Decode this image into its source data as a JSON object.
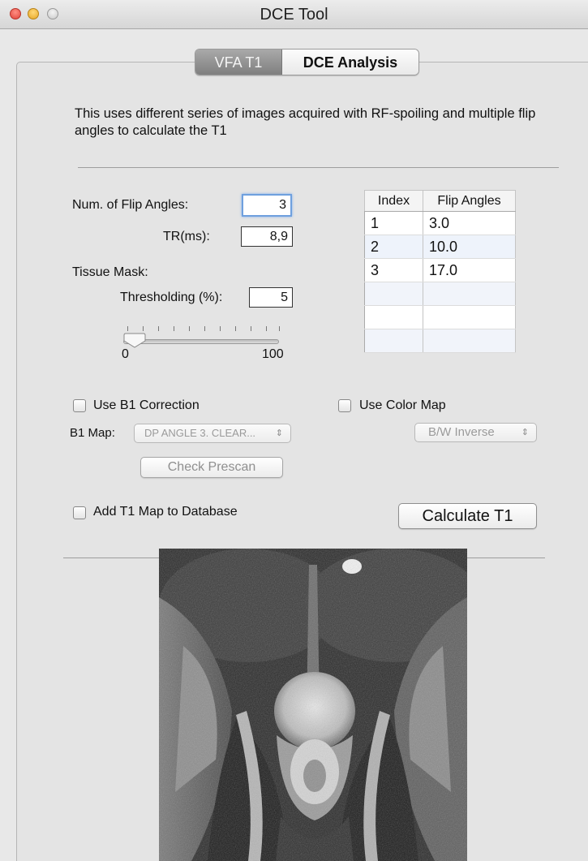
{
  "window": {
    "title": "DCE Tool"
  },
  "tabs": [
    {
      "label": "VFA T1",
      "active": true
    },
    {
      "label": "DCE Analysis",
      "active": false
    }
  ],
  "description": "This uses different series of images acquired with RF-spoiling and multiple flip angles to calculate the T1",
  "form": {
    "num_flip_angles_label": "Num. of Flip Angles:",
    "num_flip_angles_value": "3",
    "tr_label": "TR(ms):",
    "tr_value": "8,9",
    "tissue_mask_label": "Tissue Mask:",
    "thresholding_label": "Thresholding (%):",
    "thresholding_value": "5",
    "slider": {
      "min_label": "0",
      "max_label": "100",
      "value": 5
    }
  },
  "flip_table": {
    "headers": [
      "Index",
      "Flip Angles"
    ],
    "rows": [
      [
        "1",
        "3.0"
      ],
      [
        "2",
        "10.0"
      ],
      [
        "3",
        "17.0"
      ],
      [
        "",
        ""
      ],
      [
        "",
        ""
      ],
      [
        "",
        ""
      ]
    ]
  },
  "options": {
    "b1_correction_label": "Use B1 Correction",
    "b1_correction_checked": false,
    "color_map_label": "Use Color Map",
    "color_map_checked": false,
    "b1_map_label": "B1 Map:",
    "b1_map_selected": "DP ANGLE 3. CLEAR...",
    "color_map_selected": "B/W Inverse",
    "check_prescan_label": "Check Prescan",
    "add_t1_label": "Add T1 Map to Database",
    "add_t1_checked": false,
    "calculate_label": "Calculate T1"
  },
  "colors": {
    "focus_ring": "#6fa0de",
    "active_tab": "#8f8f8f",
    "window_bg": "#e8e8e8"
  },
  "icons": {
    "close": "close-window-icon",
    "minimize": "minimize-window-icon",
    "zoom": "zoom-window-icon",
    "popup_arrows": "updown-arrows-icon"
  }
}
